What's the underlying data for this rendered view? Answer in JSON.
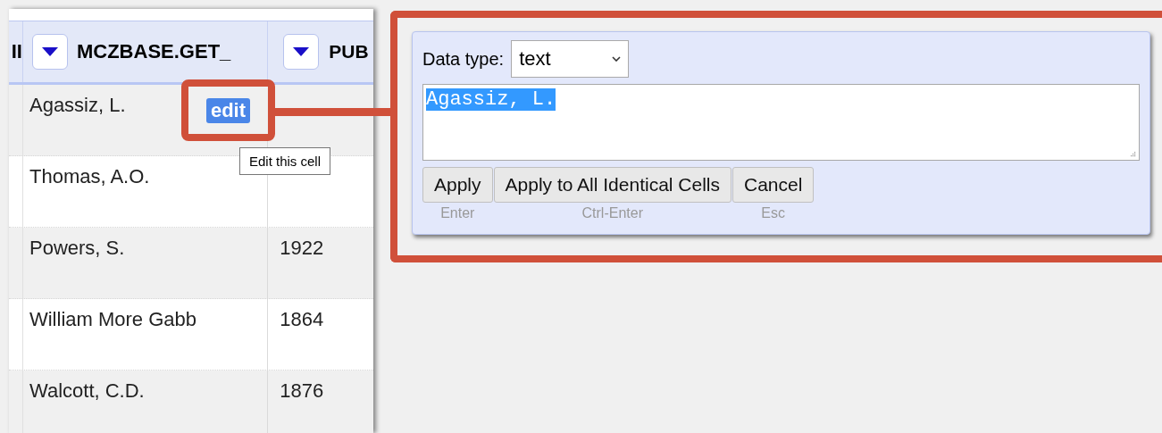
{
  "table": {
    "edge_label": "II",
    "columns": [
      {
        "label": "MCZBASE.GET_",
        "menu": true
      },
      {
        "label": "PUB",
        "menu": true
      }
    ],
    "rows": [
      {
        "cells": [
          "Agassiz, L."
        ]
      },
      {
        "cells": [
          "Thomas, A.O."
        ]
      },
      {
        "cells": [
          "Powers, S.",
          "1922"
        ]
      },
      {
        "cells": [
          "William More Gabb",
          "1864"
        ]
      },
      {
        "cells": [
          "Walcott, C.D.",
          "1876"
        ]
      }
    ]
  },
  "edit_marker": {
    "label": "edit",
    "highlighted": true
  },
  "tooltip": "Edit this cell",
  "editor": {
    "data_type_label": "Data type:",
    "data_type": "text",
    "value": "Agassiz, L.",
    "value_selected": true,
    "buttons": [
      {
        "label": "Apply",
        "shortcut": "Enter"
      },
      {
        "label": "Apply to All Identical Cells",
        "shortcut": "Ctrl-Enter"
      },
      {
        "label": "Cancel",
        "shortcut": "Esc"
      }
    ]
  }
}
